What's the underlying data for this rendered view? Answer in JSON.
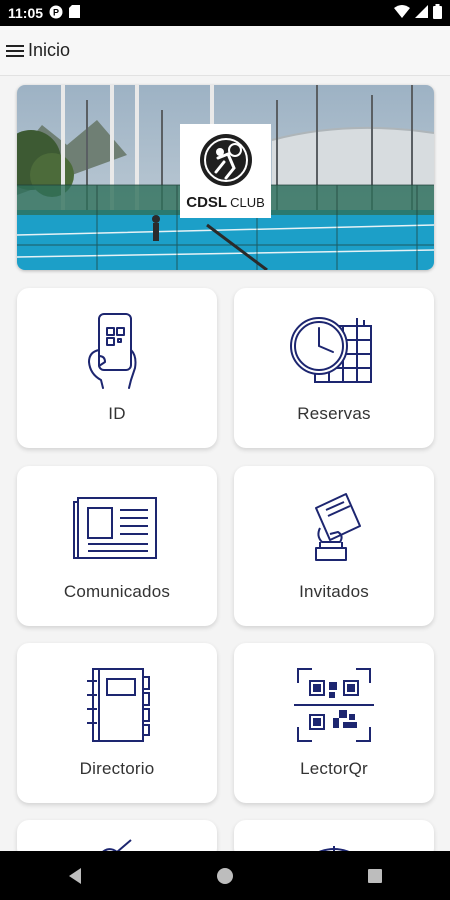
{
  "status_bar": {
    "time": "11:05"
  },
  "app_bar": {
    "title": "Inicio"
  },
  "banner": {
    "logo_text": "CDSL",
    "logo_subtext": "CLUB"
  },
  "menu": {
    "id": "ID",
    "reservas": "Reservas",
    "comunicados": "Comunicados",
    "invitados": "Invitados",
    "directorio": "Directorio",
    "lectorqr": "LectorQr"
  },
  "colors": {
    "icon_stroke": "#1d2670",
    "court_blue": "#1c9fc8",
    "status_bar": "#000000",
    "card_bg": "#ffffff"
  }
}
